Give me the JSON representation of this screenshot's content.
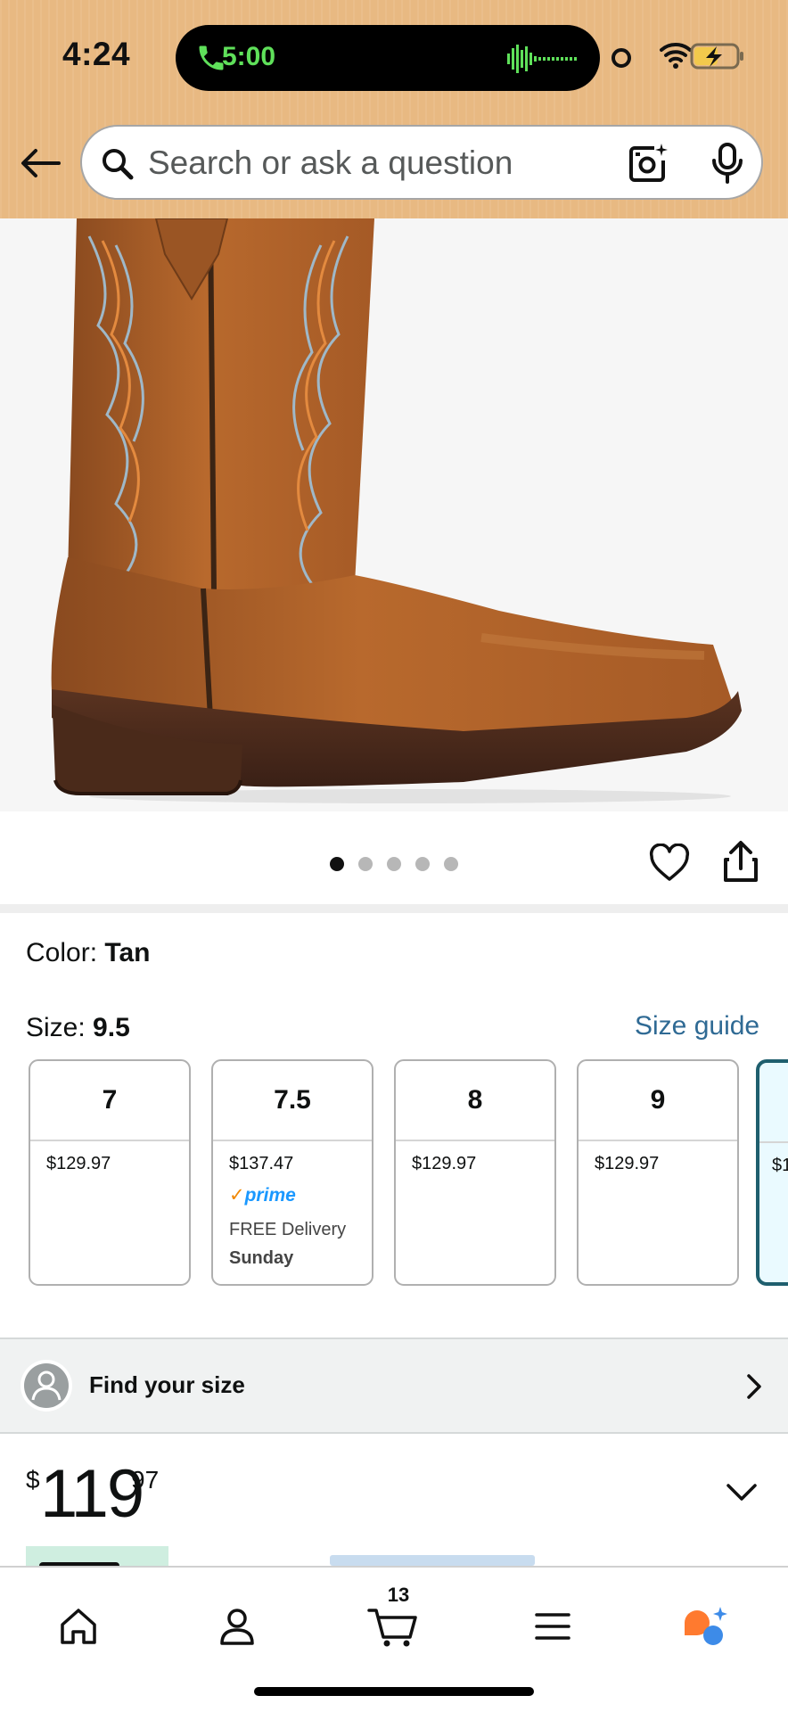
{
  "status_bar": {
    "time": "4:24",
    "call_time": "5:00"
  },
  "search": {
    "placeholder": "Search or ask a question"
  },
  "product": {
    "image_icon": "western-boot-image",
    "pager": {
      "pages": 5,
      "active_index": 0
    },
    "color_label": "Color:",
    "color_value": "Tan",
    "size_label": "Size:",
    "size_value": "9.5",
    "size_guide_label": "Size guide",
    "sizes": [
      {
        "size": "7",
        "price": "$129.97"
      },
      {
        "size": "7.5",
        "price": "$137.47",
        "prime": "prime",
        "delivery": "FREE Delivery",
        "delivery_day": "Sunday"
      },
      {
        "size": "8",
        "price": "$129.97"
      },
      {
        "size": "9",
        "price": "$129.97"
      },
      {
        "size": "",
        "price": "$1",
        "selected": true
      }
    ],
    "find_size_label": "Find your size",
    "price": {
      "symbol": "$",
      "whole": "119",
      "fraction": "97"
    }
  },
  "bottom_nav": {
    "items": [
      "home-icon",
      "account-icon",
      "cart-icon",
      "menu-icon",
      "rufus-ai-icon"
    ],
    "cart_count": "13"
  },
  "colors": {
    "header_bg": "#e8b982",
    "link": "#2f6a94",
    "selected_border": "#1f5f6e",
    "call_green": "#5fe05a",
    "prime_blue": "#1a98ff"
  }
}
